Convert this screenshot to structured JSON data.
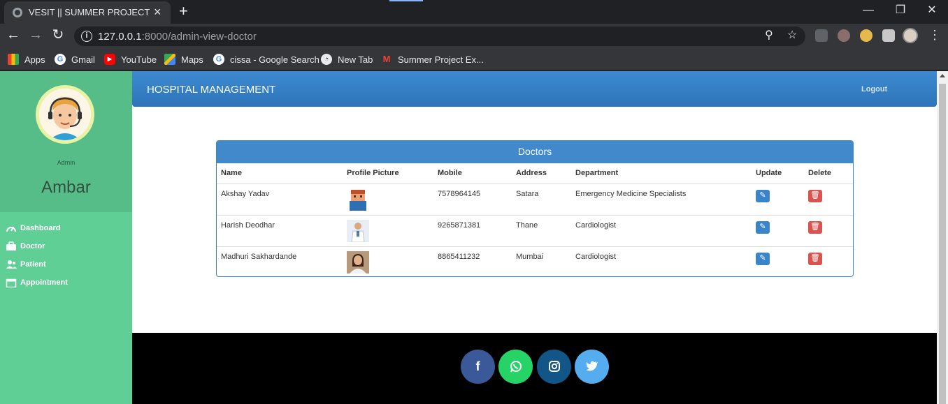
{
  "browser": {
    "tab_title": "VESIT || SUMMER PROJECT",
    "url_host": "127.0.0.1",
    "url_rest": ":8000/admin-view-doctor",
    "bookmarks": [
      {
        "label": "Apps",
        "icon": "apps-grid-icon"
      },
      {
        "label": "Gmail",
        "icon": "google-icon"
      },
      {
        "label": "YouTube",
        "icon": "youtube-icon"
      },
      {
        "label": "Maps",
        "icon": "maps-icon"
      },
      {
        "label": "cissa - Google Search",
        "icon": "google-icon"
      },
      {
        "label": "New Tab",
        "icon": "globe-icon"
      },
      {
        "label": "Summer Project Ex...",
        "icon": "gmail-icon"
      }
    ]
  },
  "sidebar": {
    "role": "Admin",
    "name": "Ambar",
    "items": [
      {
        "label": "Dashboard",
        "icon": "dashboard-icon"
      },
      {
        "label": "Doctor",
        "icon": "briefcase-icon"
      },
      {
        "label": "Patient",
        "icon": "users-icon"
      },
      {
        "label": "Appointment",
        "icon": "calendar-icon"
      }
    ]
  },
  "header": {
    "brand": "HOSPITAL MANAGEMENT",
    "logout": "Logout"
  },
  "doctors_panel": {
    "title": "Doctors",
    "columns": [
      "Name",
      "Profile Picture",
      "Mobile",
      "Address",
      "Department",
      "Update",
      "Delete"
    ],
    "rows": [
      {
        "name": "Akshay Yadav",
        "mobile": "7578964145",
        "address": "Satara",
        "department": "Emergency Medicine Specialists"
      },
      {
        "name": "Harish Deodhar",
        "mobile": "9265871381",
        "address": "Thane",
        "department": "Cardiologist"
      },
      {
        "name": "Madhuri Sakhardande",
        "mobile": "8865411232",
        "address": "Mumbai",
        "department": "Cardiologist"
      }
    ]
  },
  "footer": {
    "social": [
      {
        "icon": "facebook-icon",
        "color": "#3b5998"
      },
      {
        "icon": "whatsapp-icon",
        "color": "#25d366"
      },
      {
        "icon": "instagram-icon",
        "color": "#125688"
      },
      {
        "icon": "twitter-icon",
        "color": "#55acee"
      }
    ]
  },
  "colors": {
    "sidebar": "#5fcf96",
    "header": "#337ab7",
    "panel_heading": "#4189cb",
    "update_button": "#3a85c9",
    "delete_button": "#d9534f"
  }
}
